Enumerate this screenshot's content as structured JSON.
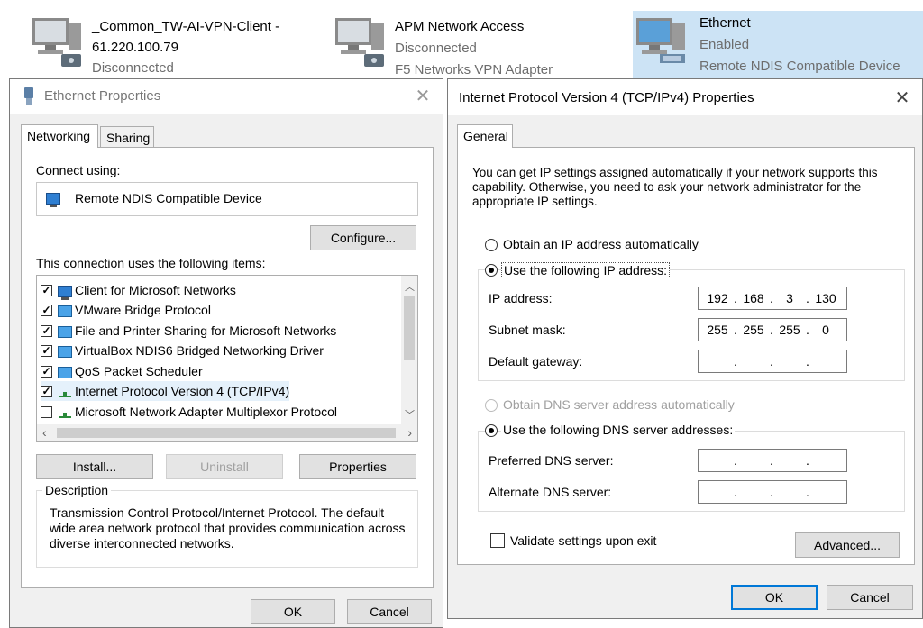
{
  "connections": [
    {
      "name": "_Common_TW-AI-VPN-Client -",
      "name2": "61.220.100.79",
      "status": "Disconnected",
      "device": ""
    },
    {
      "name": "APM Network Access",
      "status": "Disconnected",
      "device": "F5 Networks VPN Adapter"
    },
    {
      "name": "Ethernet",
      "status": "Enabled",
      "device": "Remote NDIS Compatible Device"
    }
  ],
  "ethernet_props": {
    "title": "Ethernet Properties",
    "tabs": [
      "Networking",
      "Sharing"
    ],
    "connect_using_label": "Connect using:",
    "device": "Remote NDIS Compatible Device",
    "configure_label": "Configure...",
    "items_label": "This connection uses the following items:",
    "items": [
      {
        "label": "Client for Microsoft Networks",
        "checked": true
      },
      {
        "label": "VMware Bridge Protocol",
        "checked": true
      },
      {
        "label": "File and Printer Sharing for Microsoft Networks",
        "checked": true
      },
      {
        "label": "VirtualBox NDIS6 Bridged Networking Driver",
        "checked": true
      },
      {
        "label": "QoS Packet Scheduler",
        "checked": true
      },
      {
        "label": "Internet Protocol Version 4 (TCP/IPv4)",
        "checked": true
      },
      {
        "label": "Microsoft Network Adapter Multiplexor Protocol",
        "checked": false
      }
    ],
    "install_label": "Install...",
    "uninstall_label": "Uninstall",
    "properties_label": "Properties",
    "description_label": "Description",
    "description": "Transmission Control Protocol/Internet Protocol. The default wide area network protocol that provides communication across diverse interconnected networks.",
    "ok_label": "OK",
    "cancel_label": "Cancel"
  },
  "ipv4_props": {
    "title": "Internet Protocol Version 4 (TCP/IPv4) Properties",
    "tab": "General",
    "intro": "You can get IP settings assigned automatically if your network supports this capability. Otherwise, you need to ask your network administrator for the appropriate IP settings.",
    "obtain_ip_auto": "Obtain an IP address automatically",
    "use_following_ip": "Use the following IP address:",
    "ip_address_label": "IP address:",
    "ip_address": [
      "192",
      "168",
      "3",
      "130"
    ],
    "subnet_label": "Subnet mask:",
    "subnet": [
      "255",
      "255",
      "255",
      "0"
    ],
    "gateway_label": "Default gateway:",
    "gateway": [
      "",
      "",
      "",
      ""
    ],
    "obtain_dns_auto": "Obtain DNS server address automatically",
    "use_following_dns": "Use the following DNS server addresses:",
    "preferred_dns_label": "Preferred DNS server:",
    "alternate_dns_label": "Alternate DNS server:",
    "validate_label": "Validate settings upon exit",
    "advanced_label": "Advanced...",
    "ok_label": "OK",
    "cancel_label": "Cancel"
  },
  "colors": {
    "selection": "#cce3f5",
    "accent": "#0078d7"
  }
}
